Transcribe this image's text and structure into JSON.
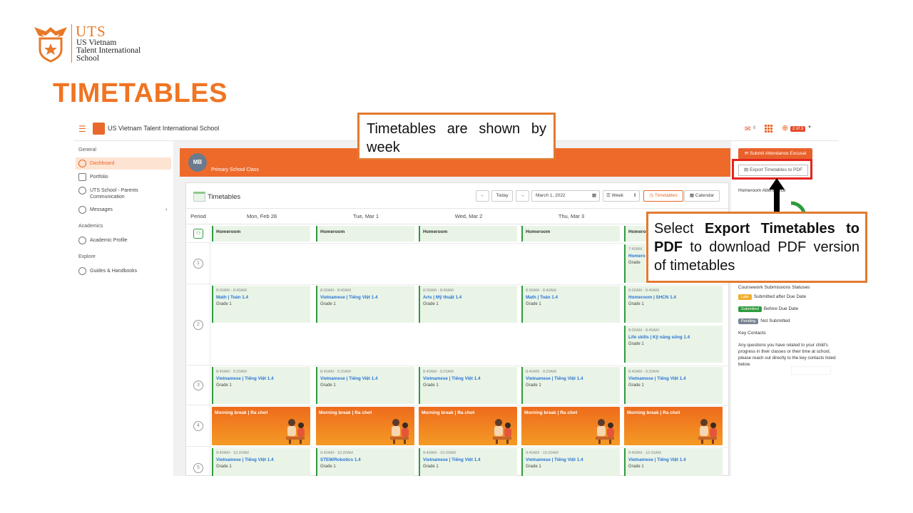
{
  "logo": {
    "short": "UTS",
    "line1": "US Vietnam",
    "line2": "Talent International",
    "line3": "School"
  },
  "slide_title": "TIMETABLES",
  "colors": {
    "accent": "#f07422",
    "brand_orange": "#ee6a2b",
    "green": "#2e9b3e",
    "link": "#2a74d6",
    "highlight_red": "#e52420"
  },
  "topbar": {
    "school_name": "US Vietnam Talent International School",
    "mail_count": "0",
    "page_badge": "2 of 3",
    "icons": [
      "menu-icon",
      "mail-icon",
      "apps-grid-icon",
      "globe-icon",
      "caret-down-icon"
    ]
  },
  "sidebar": {
    "sections": [
      {
        "label": "General",
        "items": [
          {
            "label": "Dashboard",
            "icon": "dashboard-icon",
            "active": true
          },
          {
            "label": "Portfolio",
            "icon": "portfolio-icon"
          },
          {
            "label": "UTS School - Parents Communication",
            "icon": "users-icon"
          },
          {
            "label": "Messages",
            "icon": "messages-icon"
          }
        ]
      },
      {
        "label": "Academics",
        "items": [
          {
            "label": "Academic Profile",
            "icon": "profile-icon"
          }
        ]
      },
      {
        "label": "Explore",
        "items": [
          {
            "label": "Guides & Handbooks",
            "icon": "guides-icon"
          }
        ]
      }
    ]
  },
  "class_banner": {
    "avatar": "MB",
    "label": "Primary School Class"
  },
  "timetable": {
    "title": "Timetables",
    "controls": {
      "today": "Today",
      "date": "March 1, 2022",
      "view": "Week",
      "timetables": "Timetables",
      "calendar": "Calendar"
    },
    "period_header": "Period",
    "days": [
      "Mon, Feb 28",
      "Tue, Mar 1",
      "Wed, Mar 2",
      "Thu, Mar 3",
      ""
    ],
    "periods": [
      "1",
      "2",
      "3",
      "4",
      "5"
    ],
    "homeroom_label": "Homeroom",
    "fri_homeroom_extra": {
      "time": "7:45AM",
      "subject": "Homero",
      "grade": "Grade"
    },
    "p2": [
      {
        "time": "8:00AM - 8:40AM",
        "subject": "Math | Toán 1.4",
        "grade": "Grade 1"
      },
      {
        "time": "8:00AM - 8:40AM",
        "subject": "Vietnamese | Tiếng Việt 1.4",
        "grade": "Grade 1"
      },
      {
        "time": "8:00AM - 8:40AM",
        "subject": "Arts | Mỹ thuật 1.4",
        "grade": "Grade 1"
      },
      {
        "time": "8:00AM - 8:40AM",
        "subject": "Math | Toán 1.4",
        "grade": "Grade 1"
      },
      {
        "time": "8:00AM - 8:40AM",
        "subject": "Homeroom | SHCN 1.4",
        "grade": "Grade 1"
      }
    ],
    "p2_extra": {
      "time": "8:00AM - 8:40AM",
      "subject": "Life skills | Kỹ năng sống 1.4",
      "grade": "Grade 1"
    },
    "p3": [
      {
        "time": "8:40AM - 9:20AM",
        "subject": "Vietnamese | Tiếng Việt 1.4",
        "grade": "Grade 1"
      },
      {
        "time": "8:40AM - 9:20AM",
        "subject": "Vietnamese | Tiếng Việt 1.4",
        "grade": "Grade 1"
      },
      {
        "time": "8:40AM - 9:20AM",
        "subject": "Vietnamese | Tiếng Việt 1.4",
        "grade": "Grade 1"
      },
      {
        "time": "8:40AM - 9:20AM",
        "subject": "Vietnamese | Tiếng Việt 1.4",
        "grade": "Grade 1"
      },
      {
        "time": "8:40AM - 9:20AM",
        "subject": "Vietnamese | Tiếng Việt 1.4",
        "grade": "Grade 1"
      }
    ],
    "break_label": "Morning break | Ra chơi",
    "p5": [
      {
        "time": "9:40AM - 10:20AM",
        "subject": "Vietnamese | Tiếng Việt 1.4",
        "grade": "Grade 1"
      },
      {
        "time": "9:40AM - 10:20AM",
        "subject": "STEM/Robotics 1.4",
        "grade": "Grade 1"
      },
      {
        "time": "9:40AM - 10:20AM",
        "subject": "Vietnamese | Tiếng Việt 1.4",
        "grade": "Grade 1"
      },
      {
        "time": "9:40AM - 10:20AM",
        "subject": "Vietnamese | Tiếng Việt 1.4",
        "grade": "Grade 1"
      },
      {
        "time": "9:40AM - 10:20AM",
        "subject": "Vietnamese | Tiếng Việt 1.4",
        "grade": "Grade 1"
      }
    ]
  },
  "right_panel": {
    "submit_attendance": "Submit Attendance Excusal",
    "export_pdf": "Export Timetables to PDF",
    "homeroom_attendance": "Homeroom Attendance",
    "coursework_title": "Coursework Submissions Statuses",
    "legend": [
      {
        "badge": "Late",
        "text": "Submitted after Due Date",
        "color": "#f0ad2e"
      },
      {
        "badge": "Submitted",
        "text": "Before Due Date",
        "color": "#2e9b3e"
      },
      {
        "badge": "Pending",
        "text": "Not Submitted",
        "color": "#7a8594"
      }
    ],
    "key_contacts": "Key Contacts",
    "key_contacts_text": "Any questions you have related to your child's progress in their classes or their time at school, please reach out directly to the key contacts listed below."
  },
  "callouts": {
    "week": "Timetables are shown by week",
    "export_pre": "Select ",
    "export_bold": "Export Timetables to PDF",
    "export_post": " to download PDF version of timetables"
  }
}
